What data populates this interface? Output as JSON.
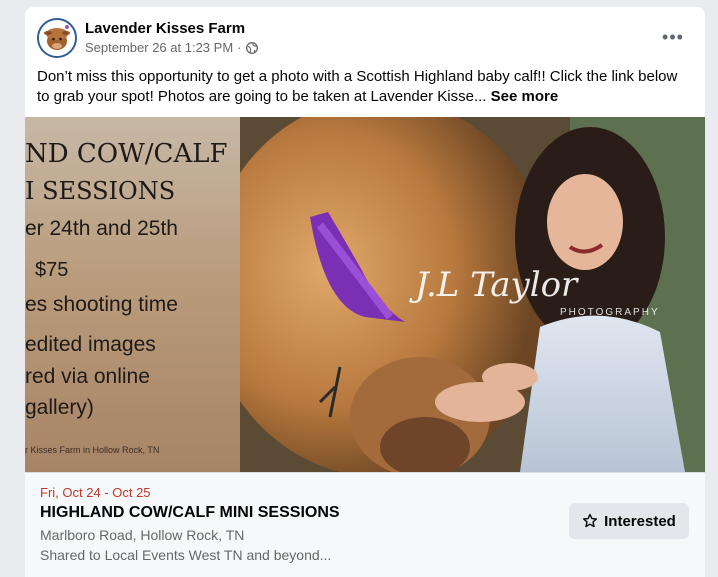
{
  "post": {
    "author": "Lavender Kisses Farm",
    "timestamp": "September 26 at 1:23 PM",
    "separator": "·",
    "privacy_icon": "globe-icon",
    "menu_icon": "more-options-icon",
    "body": "Don’t miss this opportunity to get a photo with a Scottish Highland baby calf!!  Click the link below to grab your spot!  Photos are going to be taken at Lavender Kisse...",
    "see_more": "See more"
  },
  "image": {
    "flyer_lines": [
      "ND COW/CALF",
      "I SESSIONS",
      "er 24th and 25th",
      "$75",
      "es shooting time",
      "edited images",
      "red via online",
      "gallery)",
      "r Kisses Farm in Hollow Rock, TN"
    ],
    "watermark": "J.L Taylor",
    "watermark_sub": "PHOTOGRAPHY"
  },
  "event": {
    "date": "Fri, Oct 24 - Oct 25",
    "title": "HIGHLAND COW/CALF MINI SESSIONS",
    "location": "Marlboro Road, Hollow Rock, TN",
    "shared": "Shared to Local Events West TN and beyond...",
    "interested_label": "Interested",
    "interested_icon": "star-icon"
  },
  "colors": {
    "date_red": "#c0392b",
    "muted": "#65676b",
    "button_bg": "#e4e6eb"
  }
}
